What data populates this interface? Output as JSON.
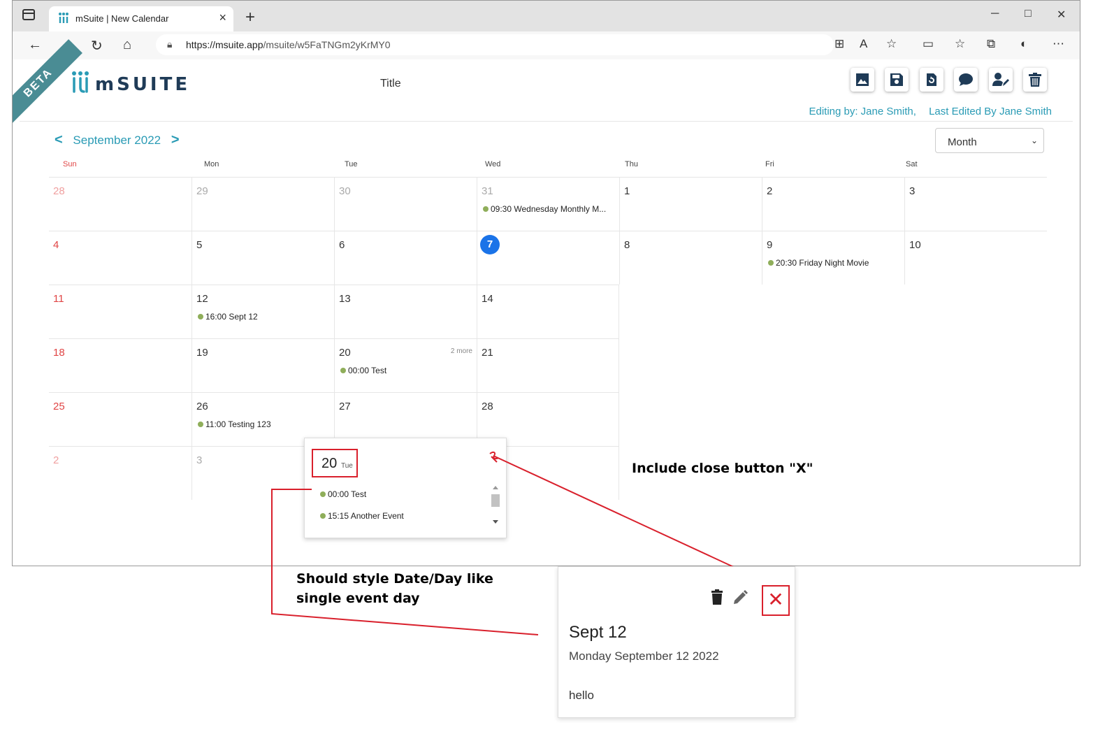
{
  "browser": {
    "tab_title": "mSuite | New Calendar",
    "tab_close": "×",
    "new_tab": "+",
    "url_host": "https://msuite.app",
    "url_path": "/msuite/w5FaTNGm2yKrMY0",
    "window_controls": [
      "─",
      "□",
      "✕"
    ]
  },
  "app": {
    "beta_label": "BETA",
    "logo_text": "mSUITE",
    "title": "Title",
    "toolbar_icons": [
      "image-icon",
      "save-icon",
      "revert-icon",
      "chat-icon",
      "user-edit-icon",
      "trash-icon"
    ],
    "editing_by": "Editing by: Jane Smith,",
    "last_edited": "Last Edited By Jane Smith",
    "accent_color": "#2a9bb5"
  },
  "calendar": {
    "month_label": "September 2022",
    "prev": "<",
    "next": ">",
    "view": "Month",
    "days_of_week": [
      "Sun",
      "Mon",
      "Tue",
      "Wed",
      "Thu",
      "Fri",
      "Sat"
    ],
    "weeks": [
      [
        "28",
        "29",
        "30",
        "31",
        "1",
        "2",
        "3"
      ],
      [
        "4",
        "5",
        "6",
        "7",
        "8",
        "9",
        "10"
      ],
      [
        "11",
        "12",
        "13",
        "14"
      ],
      [
        "18",
        "19",
        "20",
        "21"
      ],
      [
        "25",
        "26",
        "27",
        "28"
      ],
      [
        "2",
        "3"
      ]
    ],
    "events": {
      "wed_31": "09:30 Wednesday Monthly M...",
      "fri_9": "20:30 Friday Night Movie",
      "mon_12": "16:00 Sept 12",
      "tue_20": "00:00 Test",
      "mon_26": "11:00 Testing 123"
    },
    "tue_20_more": "2 more",
    "today": "7"
  },
  "popover": {
    "date_num": "20",
    "day_name": "Tue",
    "events": [
      "00:00 Test",
      "15:15 Another Event"
    ]
  },
  "annotations": {
    "close_note": "Include close button \"X\"",
    "style_note_line1": "Should style Date/Day like",
    "style_note_line2": "single event day"
  },
  "event_card": {
    "title": "Sept 12",
    "subtitle": "Monday September 12 2022",
    "body": "hello",
    "close": "✕"
  }
}
